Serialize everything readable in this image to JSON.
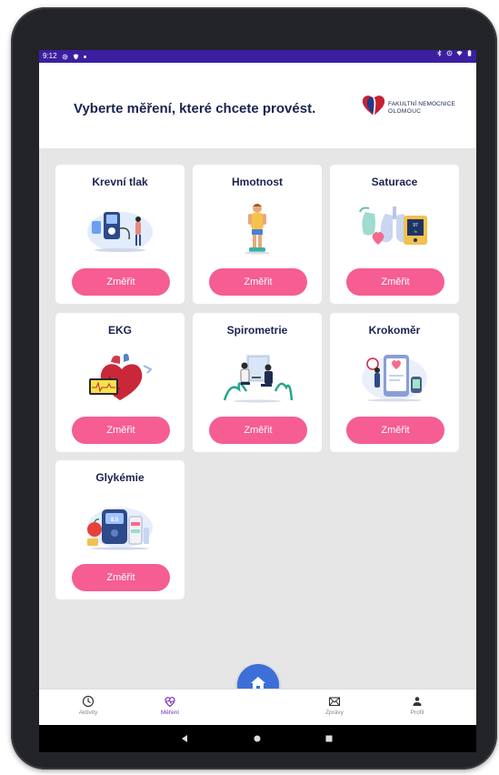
{
  "status_bar": {
    "time": "9:12"
  },
  "header": {
    "title": "Vyberte měření, které chcete provést.",
    "logo_name": "FAKULTNÍ NEMOCNICE",
    "logo_city": "OLOMOUC"
  },
  "cards": [
    {
      "name": "Krevní tlak",
      "button": "Změřit",
      "icon": "blood-pressure-illustration"
    },
    {
      "name": "Hmotnost",
      "button": "Změřit",
      "icon": "weight-scale-illustration"
    },
    {
      "name": "Saturace",
      "button": "Změřit",
      "icon": "oximeter-lungs-illustration"
    },
    {
      "name": "EKG",
      "button": "Změřit",
      "icon": "heart-ecg-illustration"
    },
    {
      "name": "Spirometrie",
      "button": "Změřit",
      "icon": "spirometry-doctor-illustration"
    },
    {
      "name": "Krokoměr",
      "button": "Změřit",
      "icon": "pedometer-illustration"
    },
    {
      "name": "Glykémie",
      "button": "Změřit",
      "icon": "glucometer-illustration"
    }
  ],
  "bottom_nav": {
    "items": [
      {
        "label": "Aktivity",
        "icon": "clock-icon",
        "active": false
      },
      {
        "label": "Měření",
        "icon": "measurement-icon",
        "active": true
      },
      {
        "label": "Zprávy",
        "icon": "mail-icon",
        "active": false
      },
      {
        "label": "Profil",
        "icon": "person-icon",
        "active": false
      }
    ],
    "home_icon": "home-icon"
  },
  "colors": {
    "accent_pink": "#f55d93",
    "status_bar": "#3b1fa0",
    "title_navy": "#1a2350",
    "home_blue": "#3d6fd8",
    "nav_active": "#7a2fb3"
  }
}
